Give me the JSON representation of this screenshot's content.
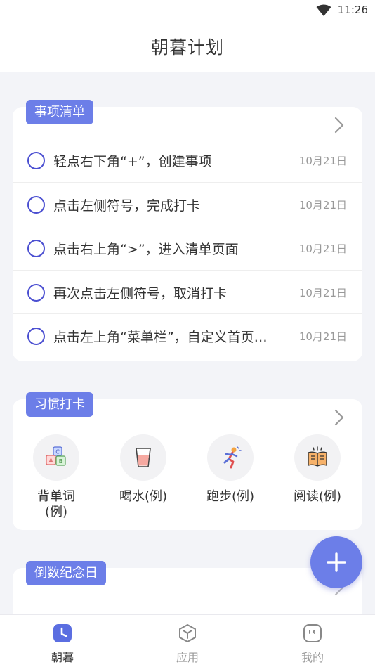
{
  "status_bar": {
    "time": "11:26",
    "wifi_icon": "wifi-icon"
  },
  "app_bar": {
    "title": "朝暮计划"
  },
  "todo_card": {
    "tag": "事项清单",
    "items": [
      {
        "text": "轻点右下角“+”，创建事项",
        "date": "10月21日"
      },
      {
        "text": "点击左侧符号，完成打卡",
        "date": "10月21日"
      },
      {
        "text": "点击右上角“>”，进入清单页面",
        "date": "10月21日"
      },
      {
        "text": "再次点击左侧符号，取消打卡",
        "date": "10月21日"
      },
      {
        "text": "点击左上角“菜单栏”，自定义首页…",
        "date": "10月21日"
      }
    ]
  },
  "habit_card": {
    "tag": "习惯打卡",
    "habits": [
      {
        "label": "背单词\n(例)",
        "icon": "abc-blocks-icon"
      },
      {
        "label": "喝水(例)",
        "icon": "water-glass-icon"
      },
      {
        "label": "跑步(例)",
        "icon": "runner-icon"
      },
      {
        "label": "阅读(例)",
        "icon": "open-book-icon"
      }
    ]
  },
  "countdown_card": {
    "tag": "倒数纪念日"
  },
  "fab": {
    "icon": "plus-icon"
  },
  "tab_bar": {
    "tabs": [
      {
        "label": "朝暮",
        "icon": "clock-icon",
        "active": true
      },
      {
        "label": "应用",
        "icon": "cube-icon",
        "active": false
      },
      {
        "label": "我的",
        "icon": "face-icon",
        "active": false
      }
    ]
  },
  "colors": {
    "accent": "#6c7ee8",
    "checkbox": "#4b4fd1",
    "background": "#f3f4f8"
  }
}
